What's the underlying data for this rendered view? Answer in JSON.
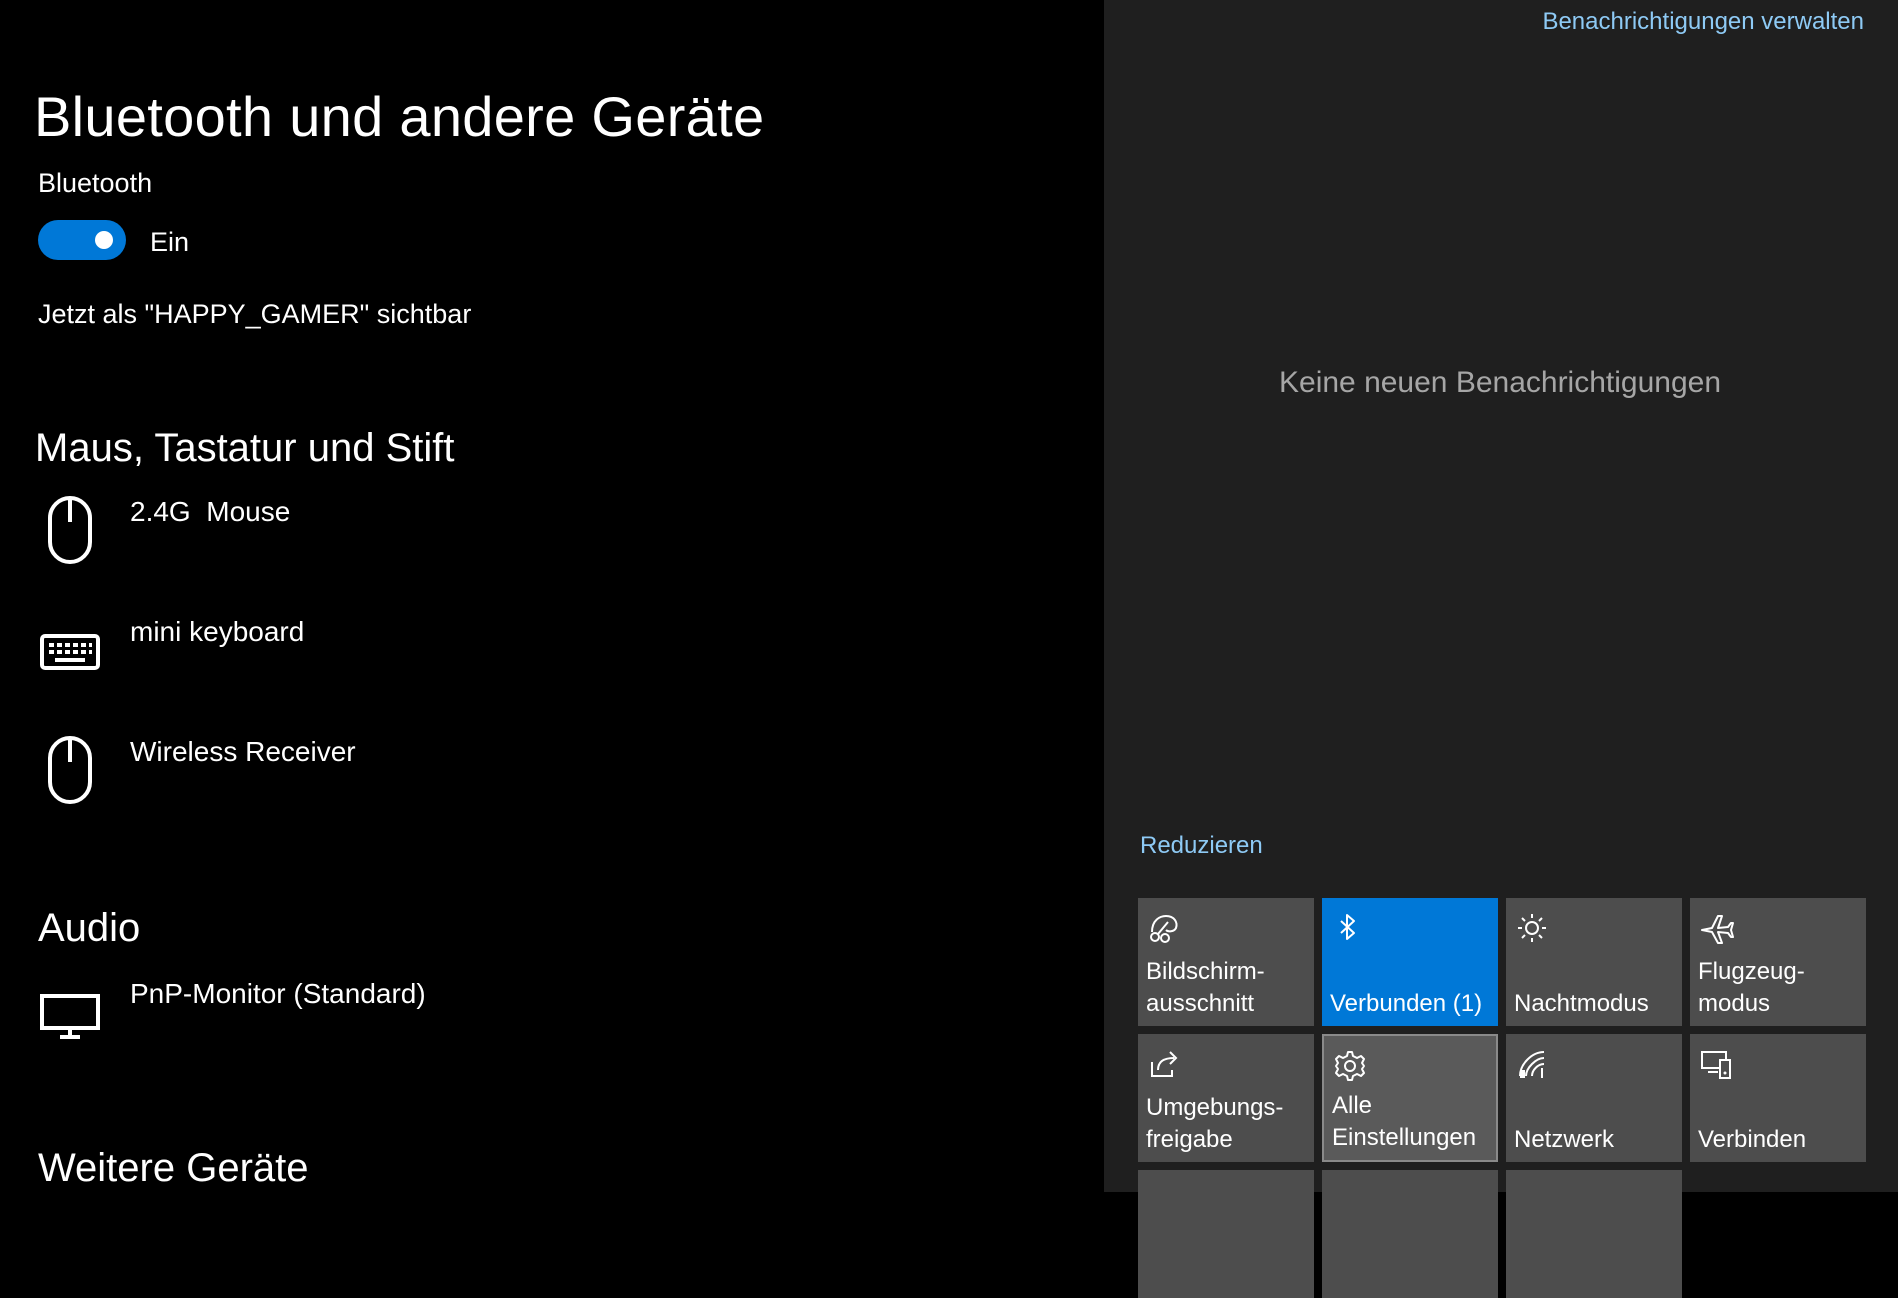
{
  "settings": {
    "title": "Bluetooth und andere Geräte",
    "bluetooth_label": "Bluetooth",
    "bluetooth_state": "Ein",
    "visibility_text": "Jetzt als \"HAPPY_GAMER\" sichtbar",
    "sections": [
      {
        "title": "Maus, Tastatur und Stift",
        "devices": [
          {
            "name": "2.4G  Mouse",
            "icon": "mouse-icon"
          },
          {
            "name": "mini keyboard",
            "icon": "keyboard-icon"
          },
          {
            "name": "Wireless Receiver",
            "icon": "mouse-icon"
          }
        ]
      },
      {
        "title": "Audio",
        "devices": [
          {
            "name": "PnP-Monitor (Standard)",
            "icon": "monitor-icon"
          }
        ]
      },
      {
        "title": "Weitere Geräte",
        "devices": []
      }
    ]
  },
  "action_center": {
    "manage_link": "Benachrichtigungen verwalten",
    "empty_message": "Keine neuen Benachrichtigungen",
    "collapse_link": "Reduzieren",
    "tiles": [
      {
        "label": "Bildschirm-\nausschnitt",
        "icon": "snip-icon",
        "active": false
      },
      {
        "label": "Verbunden (1)",
        "icon": "bluetooth-icon",
        "active": true
      },
      {
        "label": "Nachtmodus",
        "icon": "brightness-icon",
        "active": false
      },
      {
        "label": "Flugzeug-\nmodus",
        "icon": "airplane-icon",
        "active": false
      },
      {
        "label": "Umgebungs-\nfreigabe",
        "icon": "share-icon",
        "active": false
      },
      {
        "label": "Alle\nEinstellungen",
        "icon": "gear-icon",
        "active": false
      },
      {
        "label": "Netzwerk",
        "icon": "network-icon",
        "active": false
      },
      {
        "label": "Verbinden",
        "icon": "connect-icon",
        "active": false
      }
    ]
  },
  "colors": {
    "accent": "#0078d7",
    "link": "#8ecaf5",
    "tile": "#4d4d4d",
    "panel": "#1f1f1f"
  }
}
